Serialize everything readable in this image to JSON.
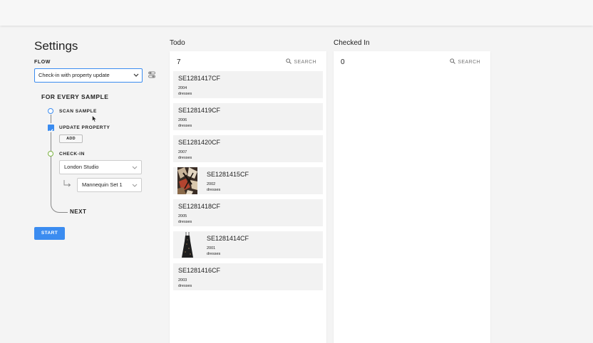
{
  "settings": {
    "title": "Settings",
    "flow_label": "FLOW",
    "flow_value": "Check-in with property update",
    "every_sample": "FOR EVERY SAMPLE",
    "steps": {
      "scan": "SCAN SAMPLE",
      "update": "UPDATE PROPERTY",
      "add": "ADD",
      "checkin": "CHECK-IN",
      "location": "London Studio",
      "sublocation": "Mannequin Set 1",
      "next": "NEXT"
    },
    "start": "START"
  },
  "todo": {
    "title": "Todo",
    "count": "7",
    "search": "SEARCH",
    "items": [
      {
        "id": "SE1281417CF",
        "year": "2004",
        "type": "dresses",
        "thumb": ""
      },
      {
        "id": "SE1281419CF",
        "year": "2006",
        "type": "dresses",
        "thumb": ""
      },
      {
        "id": "SE1281420CF",
        "year": "2007",
        "type": "dresses",
        "thumb": ""
      },
      {
        "id": "SE1281415CF",
        "year": "2002",
        "type": "dresses",
        "thumb": "patterned-fabric"
      },
      {
        "id": "SE1281418CF",
        "year": "2005",
        "type": "dresses",
        "thumb": ""
      },
      {
        "id": "SE1281414CF",
        "year": "2001",
        "type": "dresses",
        "thumb": "black-dress"
      },
      {
        "id": "SE1281416CF",
        "year": "2003",
        "type": "dresses",
        "thumb": ""
      }
    ]
  },
  "checked": {
    "title": "Checked In",
    "count": "0",
    "search": "SEARCH"
  },
  "colors": {
    "accent": "#3b8cf0",
    "checkin_dot": "#7cb342"
  }
}
